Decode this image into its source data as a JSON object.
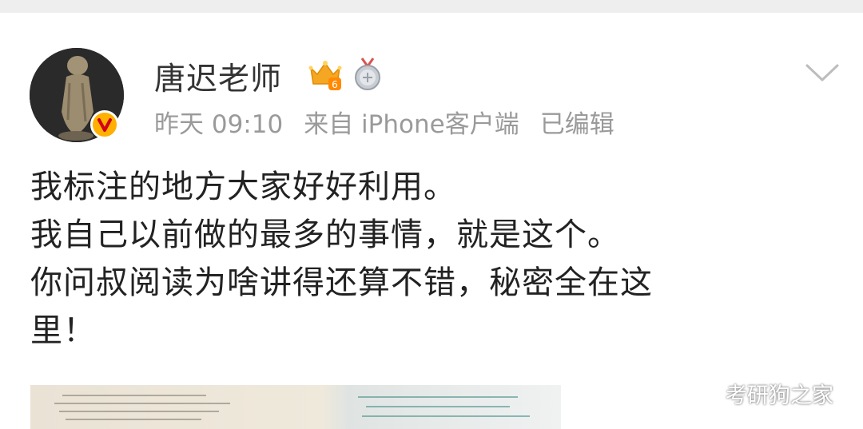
{
  "post": {
    "author": "唐迟老师",
    "meta": {
      "time": "昨天 09:10",
      "source": "来自 iPhone客户端",
      "edited": "已编辑"
    },
    "body_lines": [
      "我标注的地方大家好好利用。",
      "我自己以前做的最多的事情，就是这个。",
      "你问叔阅读为啥讲得还算不错，秘密全在这",
      "里！"
    ],
    "badges": {
      "crown_level": "6"
    }
  },
  "watermark": {
    "text": "考研狗之家"
  },
  "icons": [
    "avatar",
    "verified-badge-icon",
    "crown-badge-icon",
    "medal-badge-icon",
    "chevron-down-icon",
    "wechat-icon"
  ],
  "colors": {
    "verified": "#ffb000",
    "crown": "#f5a623",
    "meta_text": "#9a9a9a",
    "body_text": "#222222"
  }
}
